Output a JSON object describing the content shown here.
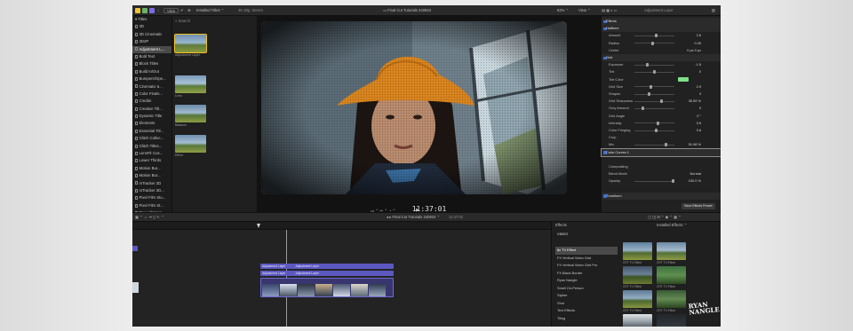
{
  "colors": {
    "accent": "#3b6fd6",
    "clip_purple": "#5b58c0",
    "selection": "#4a4a4a",
    "hat_orange": "#d8841e"
  },
  "toolbar": {
    "view_label": "View",
    "browser_title": "Installed Titles",
    "format_info": "4K 30p, Stereo",
    "project_title": "Final Cut Tutorials 240924",
    "zoom": "62%",
    "view_menu": "View",
    "inspector_title": "Adjustment Layer"
  },
  "library": {
    "title": "Titles",
    "items": [
      "3D",
      "3D Cinematic",
      "3D2P",
      "Adjustment L...",
      "Bold Text",
      "Block Titles",
      "Build In/Out",
      "Bumpers/Ope...",
      "Cinematic 6...",
      "Color Finals...",
      "Credits",
      "Creative Titl...",
      "Dynamic Title",
      "Elements",
      "Essential Titl...",
      "Glitch Collec...",
      "Glitch Titles...",
      "LensFlr Cus...",
      "Lower Thirds",
      "Motion Bur...",
      "Motion Bur...",
      "mTracker 3D",
      "mTracker 3D...",
      "Pixel Film Stu...",
      "Pixel Film St...",
      "Pro Lightspot..."
    ]
  },
  "browser": {
    "search_placeholder": "Search",
    "thumbs": [
      "Adjustment Layer",
      "Lens",
      "Balance",
      "Effect"
    ]
  },
  "viewer": {
    "timecode": "11:37:01"
  },
  "inspector": {
    "rows": [
      {
        "label": "Effects",
        "value": "",
        "type": "hdr"
      },
      {
        "label": "Halftone",
        "value": "",
        "type": "hdr"
      },
      {
        "label": "Amount",
        "value": "2.6",
        "type": "slider",
        "knob": 0.55
      },
      {
        "label": "Radius",
        "value": "0.25",
        "type": "slider",
        "knob": 0.45
      },
      {
        "label": "Center",
        "value": "0 px   0 px",
        "type": "plain"
      },
      {
        "label": "Grid",
        "value": "",
        "type": "hdr"
      },
      {
        "label": "Exposure",
        "value": "-1.5",
        "type": "slider",
        "knob": 0.3
      },
      {
        "label": "Tint",
        "value": "0",
        "type": "slider",
        "knob": 0.5
      },
      {
        "label": "Tint Color",
        "value": "",
        "type": "color"
      },
      {
        "label": "Grid Size",
        "value": "2.9",
        "type": "slider",
        "knob": 0.4
      },
      {
        "label": "Shapes",
        "value": "3",
        "type": "slider",
        "knob": 0.35
      },
      {
        "label": "Grid Sharpness",
        "value": "35.59 %",
        "type": "slider",
        "knob": 0.7
      },
      {
        "label": "Grey Amount",
        "value": "0",
        "type": "slider",
        "knob": 0.2
      },
      {
        "label": "Grid Angle",
        "value": "0 °",
        "type": "plain"
      },
      {
        "label": "Intensity",
        "value": "3.5",
        "type": "slider",
        "knob": 0.6
      },
      {
        "label": "Color Fringing",
        "value": "3.6",
        "type": "slider",
        "knob": 0.55
      },
      {
        "label": "Crop",
        "value": "",
        "type": "plain"
      },
      {
        "label": "Mix",
        "value": "51.98 %",
        "type": "slider",
        "knob": 0.8
      },
      {
        "label": "Color Curves 1",
        "value": "",
        "type": "hdr"
      },
      {
        "label": "",
        "value": "",
        "type": "plain"
      },
      {
        "label": "Compositing",
        "value": "",
        "type": "plain"
      },
      {
        "label": "Blend Mode",
        "value": "Normal",
        "type": "plain"
      },
      {
        "label": "Opacity",
        "value": "100.0 %",
        "type": "slider",
        "knob": 1.0
      },
      {
        "label": "",
        "value": "",
        "type": "plain"
      },
      {
        "label": "Transform",
        "value": "",
        "type": "hdr"
      }
    ],
    "save_button": "Save Effects Preset"
  },
  "timeline": {
    "project_title": "Final Cut Tutorials 240924",
    "duration": "11:37:02",
    "clip_labels": [
      "Adjustment Layer",
      "Adjustment Layer",
      "Adjustment Layer",
      "Adjustment Layer"
    ]
  },
  "effects": {
    "header_label": "Effects",
    "installed_label": "Installed Effects",
    "category_title": "VIDEO",
    "categories": [
      "8x TV Effect",
      "FX Vertical Video Grid",
      "FX Vertical Video Grid Pro",
      "FX Black Border",
      "Ryan Nangle",
      "Smell On-Person",
      "Stylize",
      "Shot",
      "Text Effects",
      "Tiling"
    ],
    "thumbs": [
      "CRT TV Effect",
      "CRT TV Effect",
      "CRT TV Effect",
      "CRT TV Effect",
      "CRT TV Effect",
      "CRT TV Effect",
      "CRT TV Effect",
      "CRT TV Effect"
    ],
    "watermark_text": "RYAN NANGLE"
  }
}
